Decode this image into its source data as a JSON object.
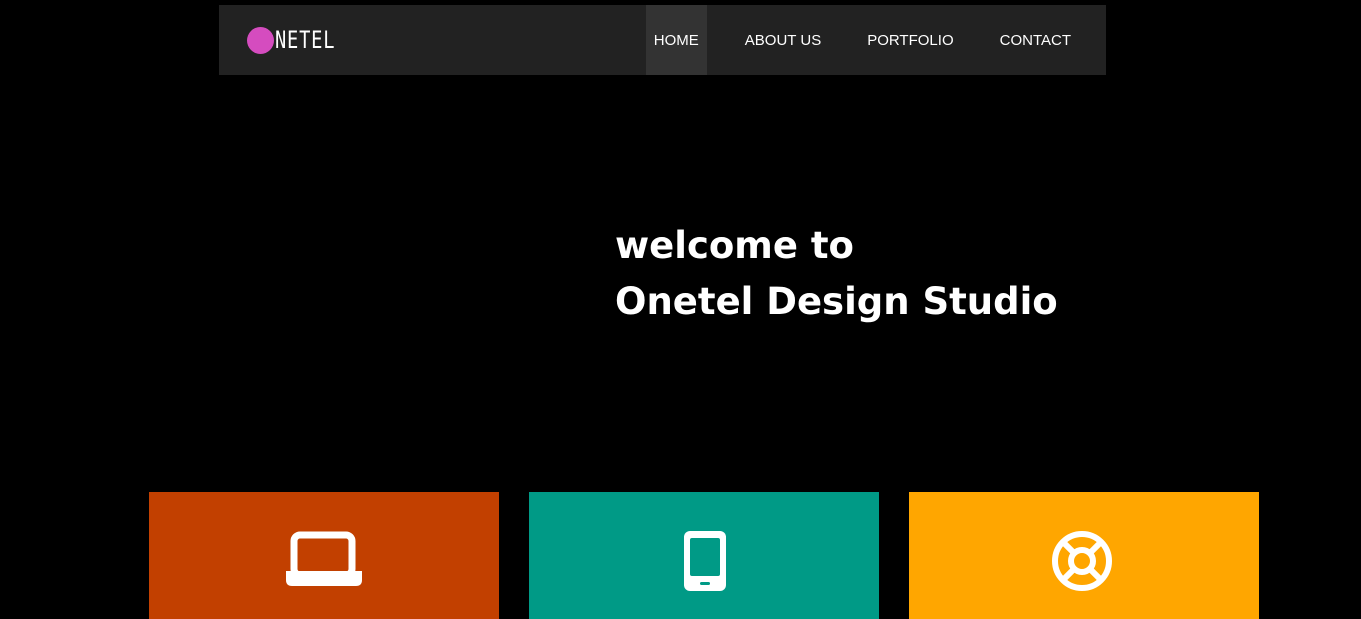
{
  "header": {
    "logo_text": "NETEL",
    "logo_dot_color": "#d54cbf",
    "background": "#222222"
  },
  "nav": {
    "items": [
      {
        "label": "HOME",
        "active": true
      },
      {
        "label": "ABOUT US",
        "active": false
      },
      {
        "label": "PORTFOLIO",
        "active": false
      },
      {
        "label": "CONTACT",
        "active": false
      }
    ]
  },
  "hero": {
    "line1": "welcome to",
    "line2": "Onetel Design Studio"
  },
  "features": [
    {
      "icon": "laptop-icon",
      "color": "#c24000"
    },
    {
      "icon": "mobile-phone-icon",
      "color": "#009a86"
    },
    {
      "icon": "lifebuoy-icon",
      "color": "#ffa600"
    }
  ]
}
